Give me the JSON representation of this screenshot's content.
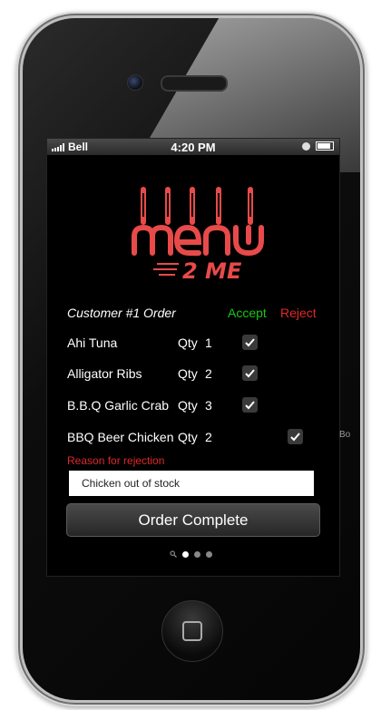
{
  "status_bar": {
    "carrier": "Bell",
    "time": "4:20 PM"
  },
  "logo": {
    "word": "menu",
    "tagline": "2 ME",
    "color": "#e84a4a"
  },
  "order": {
    "title": "Customer #1 Order",
    "accept_label": "Accept",
    "reject_label": "Reject",
    "qty_label": "Qty",
    "items": [
      {
        "name": "Ahi Tuna",
        "qty": "1",
        "checked": true,
        "column": "accept"
      },
      {
        "name": "Alligator Ribs",
        "qty": "2",
        "checked": true,
        "column": "accept"
      },
      {
        "name": "B.B.Q Garlic Crab",
        "qty": "3",
        "checked": true,
        "column": "accept"
      },
      {
        "name": "BBQ Beer Chicken",
        "qty": "2",
        "checked": true,
        "column": "reject"
      }
    ]
  },
  "rejection": {
    "label": "Reason for rejection",
    "value": "Chicken out of stock"
  },
  "complete_button": "Order Complete",
  "overflow_text": "Bo",
  "colors": {
    "accept": "#19c519",
    "reject": "#e02828"
  }
}
